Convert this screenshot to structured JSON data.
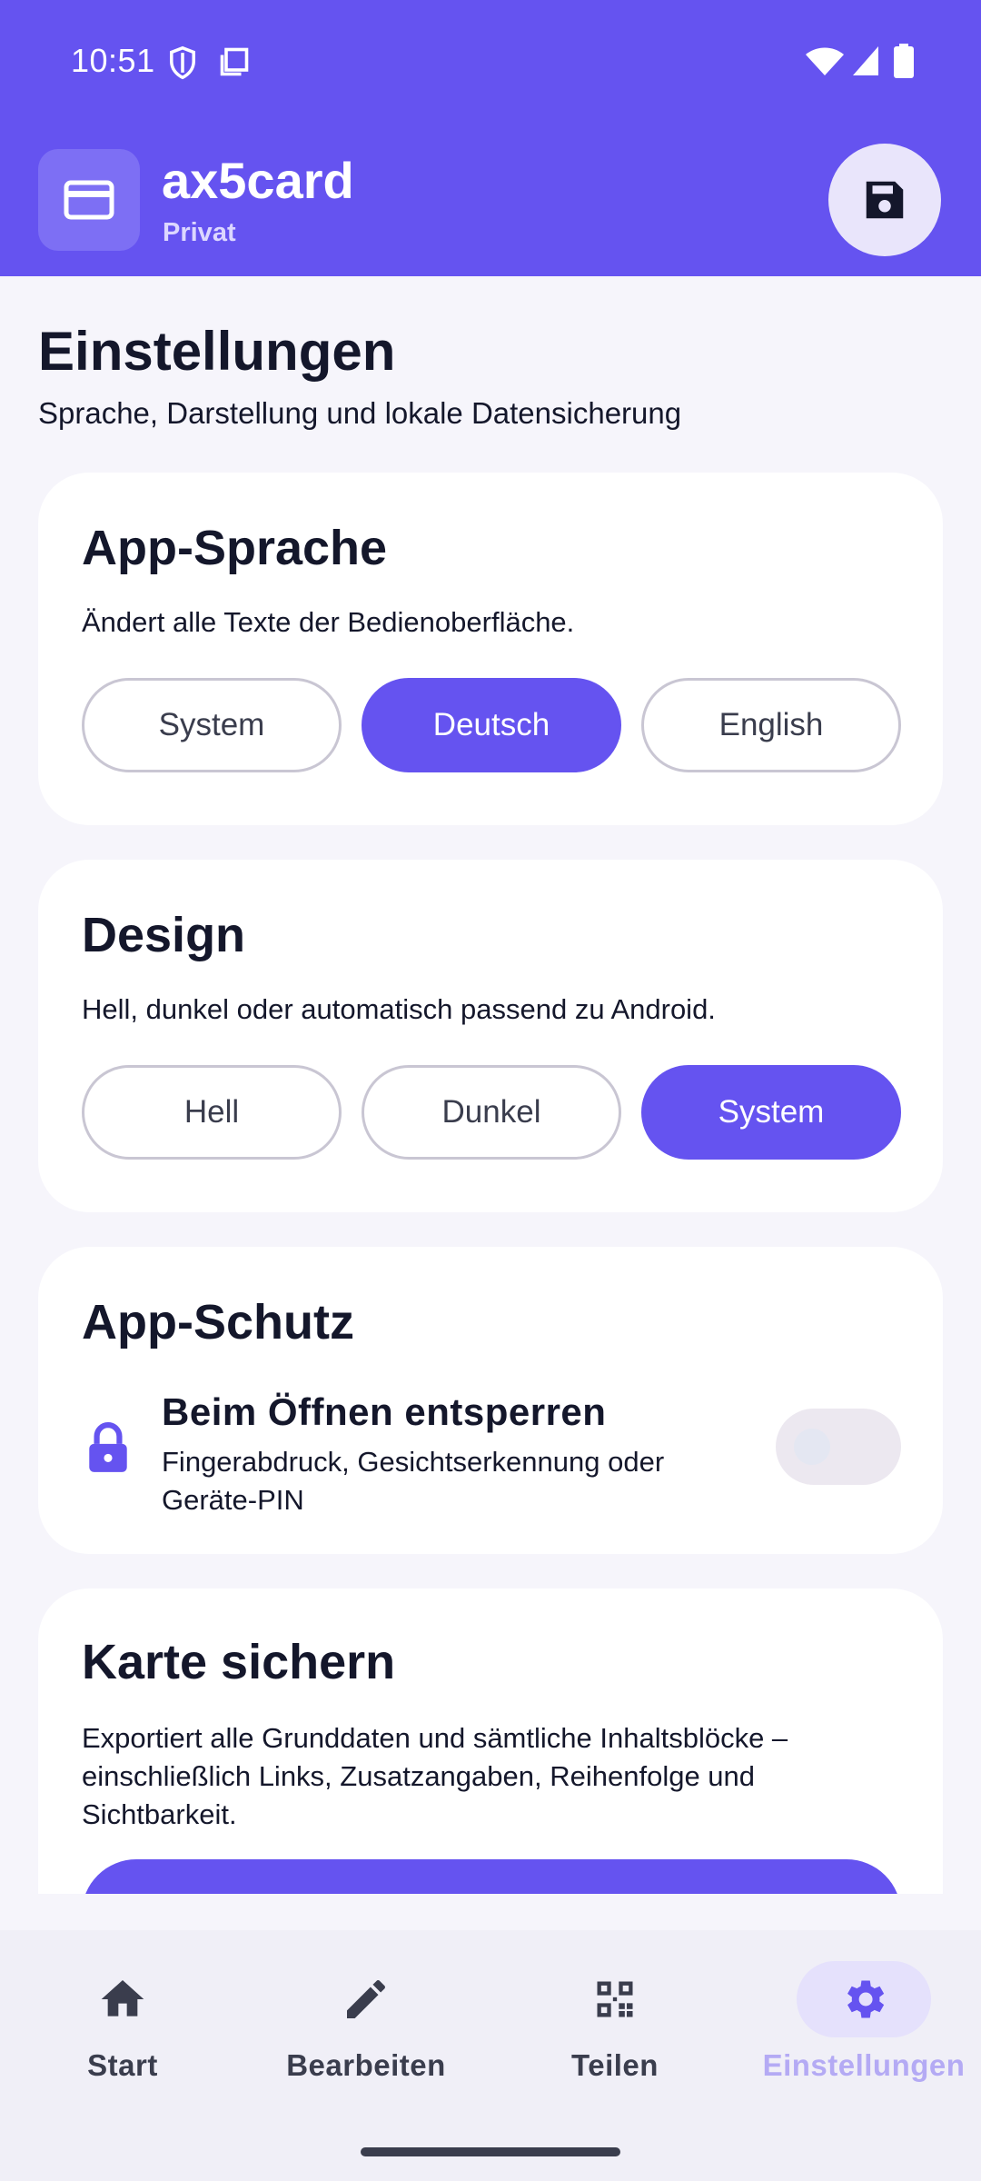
{
  "status_bar": {
    "time": "10:51",
    "icons": [
      "shield-icon",
      "screen-icon",
      "wifi-icon",
      "signal-icon",
      "battery-icon"
    ]
  },
  "header": {
    "logo_icon": "credit-card-icon",
    "title": "ax5card",
    "subtitle": "Privat",
    "save_icon": "save-icon"
  },
  "page": {
    "title": "Einstellungen",
    "subtitle": "Sprache, Darstellung und lokale Datensicherung"
  },
  "language_card": {
    "title": "App-Sprache",
    "description": "Ändert alle Texte der Bedienoberfläche.",
    "options": [
      "System",
      "Deutsch",
      "English"
    ],
    "selected": "Deutsch"
  },
  "design_card": {
    "title": "Design",
    "description": "Hell, dunkel oder automatisch passend zu Android.",
    "options": [
      "Hell",
      "Dunkel",
      "System"
    ],
    "selected": "System"
  },
  "protection_card": {
    "title": "App-Schutz",
    "toggle_title": "Beim Öffnen entsperren",
    "toggle_description": "Fingerabdruck, Gesichtserkennung oder Geräte-PIN",
    "toggle_enabled": false,
    "icon": "lock-icon"
  },
  "backup_card": {
    "title": "Karte sichern",
    "description": "Exportiert alle Grunddaten und sämtliche Inhaltsblöcke – einschließlich Links, Zusatzangaben, Reihenfolge und Sichtbarkeit."
  },
  "bottom_nav": {
    "items": [
      {
        "label": "Start",
        "icon": "home-icon"
      },
      {
        "label": "Bearbeiten",
        "icon": "pencil-icon"
      },
      {
        "label": "Teilen",
        "icon": "qr-code-icon"
      },
      {
        "label": "Einstellungen",
        "icon": "gear-icon"
      }
    ],
    "active": "Einstellungen"
  },
  "colors": {
    "primary": "#6553F0",
    "background": "#F6F5FB",
    "surface": "#FFFFFF",
    "text": "#14172B",
    "nav_active_label": "#B4AAF4"
  }
}
